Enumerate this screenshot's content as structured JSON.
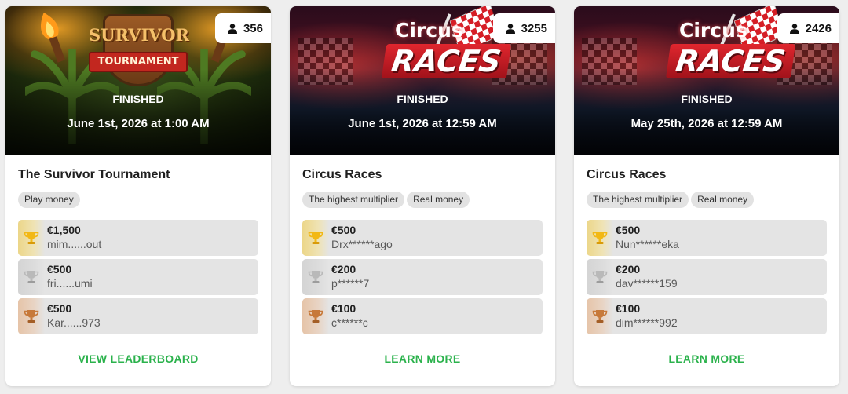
{
  "cards": [
    {
      "banner": "survivor",
      "banner_logo": {
        "line1": "SURVIVOR",
        "line2": "TOURNAMENT"
      },
      "players": "356",
      "status": "FINISHED",
      "date": "June 1st, 2026 at 1:00 AM",
      "title": "The Survivor Tournament",
      "tags": [
        "Play money"
      ],
      "prizes": [
        {
          "rank": "gold",
          "amount": "€1,500",
          "user": "mim......out"
        },
        {
          "rank": "silver",
          "amount": "€500",
          "user": "fri......umi"
        },
        {
          "rank": "bronze",
          "amount": "€500",
          "user": "Kar......973"
        }
      ],
      "action": "VIEW LEADERBOARD"
    },
    {
      "banner": "races",
      "banner_logo": {
        "line1": "Circus",
        "line2": "RACES"
      },
      "players": "3255",
      "status": "FINISHED",
      "date": "June 1st, 2026 at 12:59 AM",
      "title": "Circus Races",
      "tags": [
        "The highest multiplier",
        "Real money"
      ],
      "prizes": [
        {
          "rank": "gold",
          "amount": "€500",
          "user": "Drx******ago"
        },
        {
          "rank": "silver",
          "amount": "€200",
          "user": "p******7"
        },
        {
          "rank": "bronze",
          "amount": "€100",
          "user": "c******c"
        }
      ],
      "action": "LEARN MORE"
    },
    {
      "banner": "races",
      "banner_logo": {
        "line1": "Circus",
        "line2": "RACES"
      },
      "players": "2426",
      "status": "FINISHED",
      "date": "May 25th, 2026 at 12:59 AM",
      "title": "Circus Races",
      "tags": [
        "The highest multiplier",
        "Real money"
      ],
      "prizes": [
        {
          "rank": "gold",
          "amount": "€500",
          "user": "Nun******eka"
        },
        {
          "rank": "silver",
          "amount": "€200",
          "user": "dav******159"
        },
        {
          "rank": "bronze",
          "amount": "€100",
          "user": "dim******992"
        }
      ],
      "action": "LEARN MORE"
    }
  ],
  "colors": {
    "accent_green": "#2bb24c",
    "gold": "#f2b814",
    "silver": "#b9b9b9",
    "bronze": "#c7793a"
  },
  "icons": {
    "players": "person-icon",
    "prize": "trophy-icon"
  }
}
